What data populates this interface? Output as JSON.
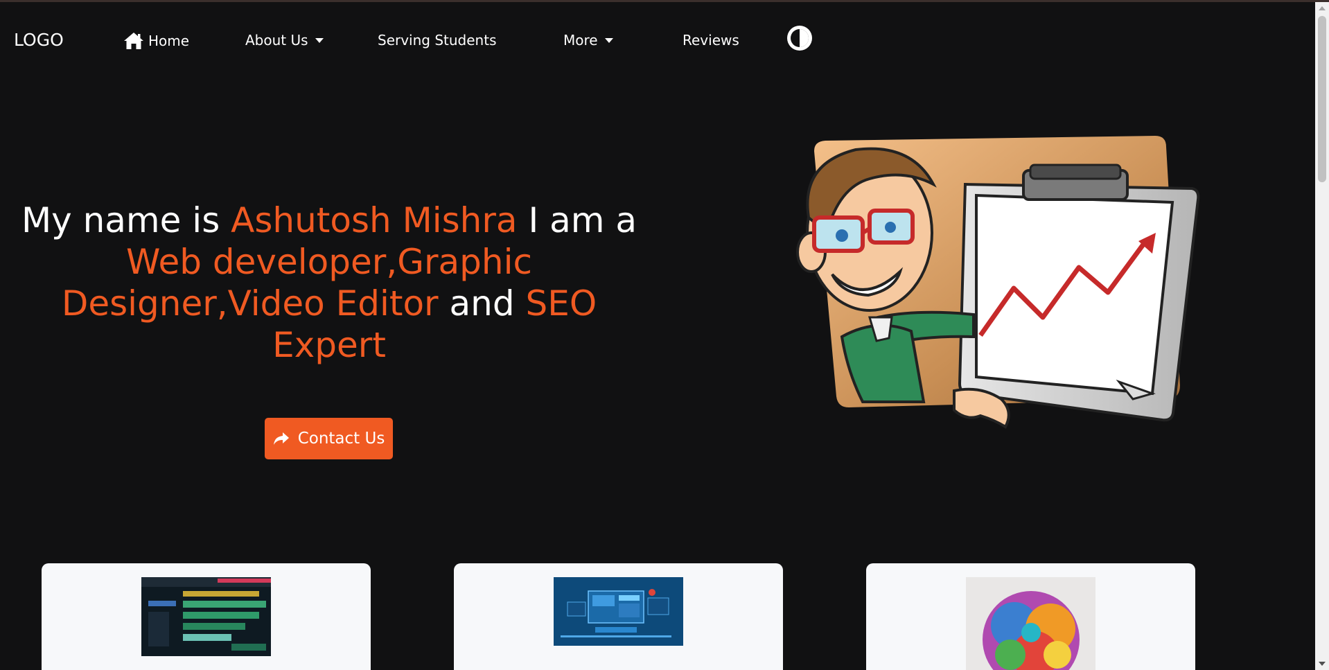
{
  "nav": {
    "logo": "LOGO",
    "items": [
      {
        "label": "Home",
        "icon": "home-icon"
      },
      {
        "label": "About Us",
        "dropdown": true
      },
      {
        "label": "Serving Students"
      },
      {
        "label": "More",
        "dropdown": true
      },
      {
        "label": "Reviews"
      }
    ],
    "theme_toggle_icon": "contrast-icon"
  },
  "hero": {
    "parts": [
      {
        "text": "My name is ",
        "highlight": false
      },
      {
        "text": "Ashutosh Mishra",
        "highlight": true
      },
      {
        "text": " I am a ",
        "highlight": false
      },
      {
        "text": "Web developer,Graphic Designer,Video Editor",
        "highlight": true
      },
      {
        "text": " and ",
        "highlight": false
      },
      {
        "text": "SEO Expert",
        "highlight": true
      }
    ],
    "cta_label": "Contact Us",
    "cta_icon": "share-icon"
  },
  "cards": [
    {
      "image": "video-editing-timeline-image"
    },
    {
      "image": "web-development-screens-image"
    },
    {
      "image": "colorful-brain-art-image"
    }
  ],
  "colors": {
    "background": "#111112",
    "accent": "#f05a22",
    "text": "#ffffff",
    "card": "#f7f8fa"
  }
}
